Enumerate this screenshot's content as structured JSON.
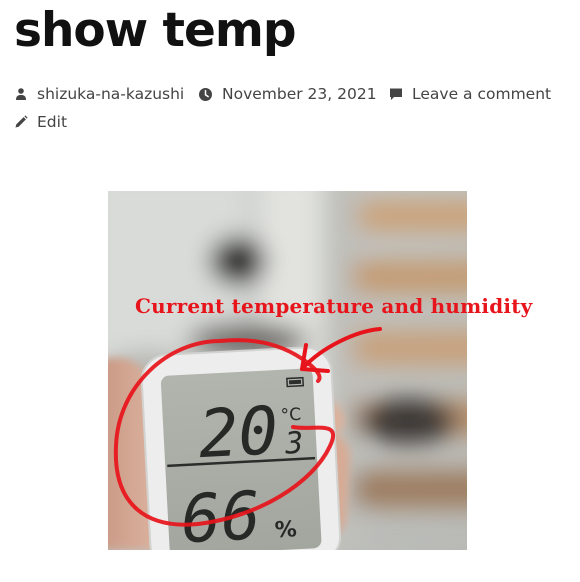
{
  "post": {
    "title": "show temp",
    "author": "shizuka-na-kazushi",
    "date": "November 23, 2021",
    "comment_link": "Leave a comment",
    "edit_link": "Edit"
  },
  "image": {
    "annotation": "Current temperature and humidity",
    "annotation_color": "#e8141b",
    "display": {
      "temperature": "20",
      "temperature_decimal": "3",
      "temperature_unit": "°C",
      "humidity": "66",
      "humidity_unit": "%"
    }
  },
  "icons": {
    "author": "person-icon",
    "date": "clock-icon",
    "comment": "comment-icon",
    "edit": "pencil-icon"
  }
}
